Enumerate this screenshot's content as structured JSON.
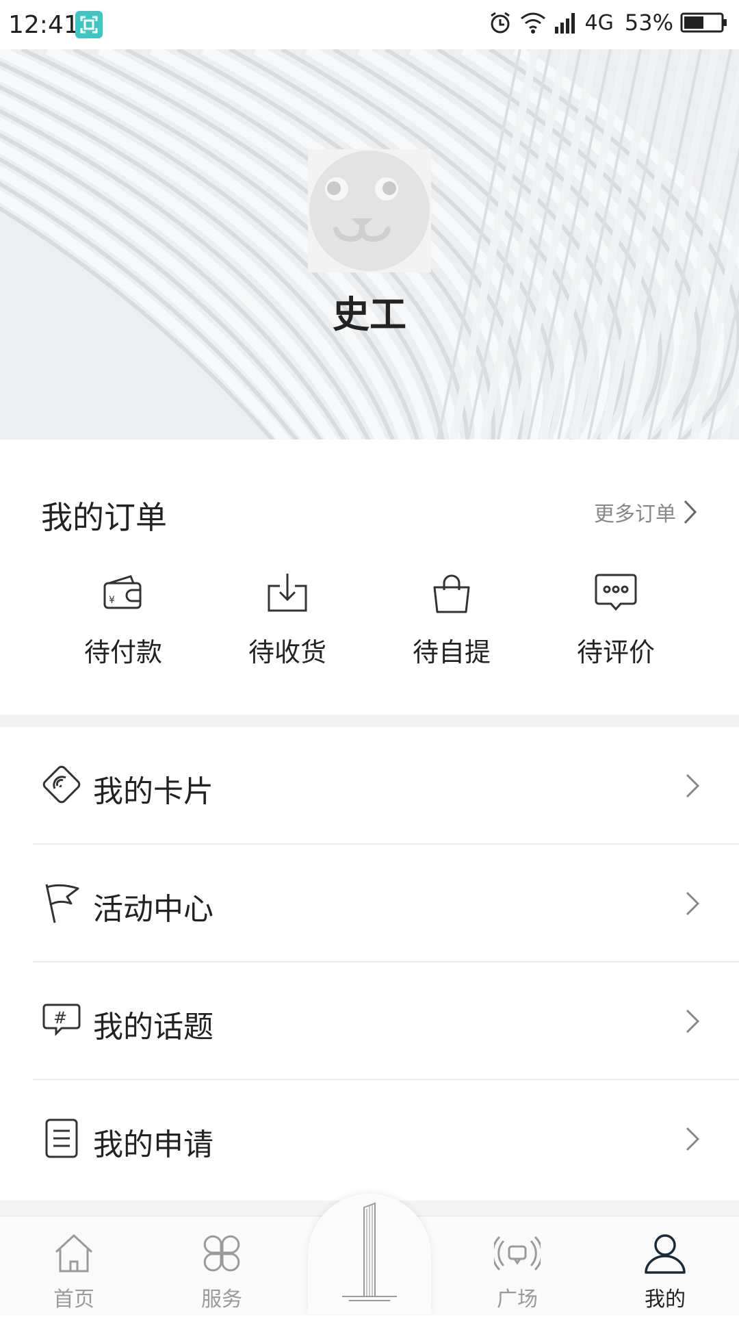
{
  "status_bar": {
    "time": "12:41",
    "network": "4G",
    "battery": "53%",
    "battery_level": 0.53,
    "icons": [
      "screen-capture-icon",
      "alarm-icon",
      "wifi-icon",
      "signal-icon",
      "battery-icon"
    ]
  },
  "profile": {
    "name": "史工",
    "avatar_icon": "bear-avatar-icon"
  },
  "orders": {
    "title": "我的订单",
    "more_label": "更多订单",
    "items": [
      {
        "label": "待付款",
        "icon": "wallet-icon"
      },
      {
        "label": "待收货",
        "icon": "download-icon"
      },
      {
        "label": "待自提",
        "icon": "shopping-bag-icon"
      },
      {
        "label": "待评价",
        "icon": "comment-icon"
      }
    ]
  },
  "menu": [
    {
      "label": "我的卡片",
      "icon": "card-icon"
    },
    {
      "label": "活动中心",
      "icon": "flag-icon"
    },
    {
      "label": "我的话题",
      "icon": "topic-icon"
    },
    {
      "label": "我的申请",
      "icon": "document-icon"
    }
  ],
  "bottom_nav": {
    "active": "我的",
    "items": [
      {
        "label": "首页",
        "icon": "home-icon"
      },
      {
        "label": "服务",
        "icon": "services-icon"
      },
      {
        "label": "",
        "icon": "building-icon"
      },
      {
        "label": "广场",
        "icon": "square-broadcast-icon"
      },
      {
        "label": "我的",
        "icon": "user-icon"
      }
    ]
  },
  "colors": {
    "accent": "#3ec6c4",
    "text": "#222222",
    "muted": "#888888",
    "nav_inactive": "#9a9a9a"
  }
}
